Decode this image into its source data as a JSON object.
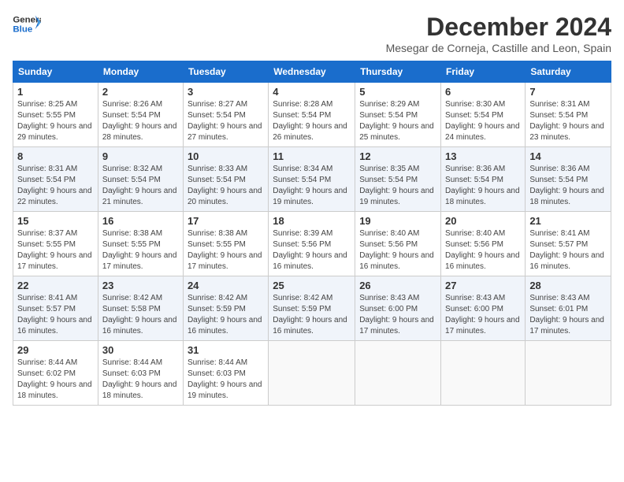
{
  "header": {
    "logo_line1": "General",
    "logo_line2": "Blue",
    "month": "December 2024",
    "location": "Mesegar de Corneja, Castille and Leon, Spain"
  },
  "weekdays": [
    "Sunday",
    "Monday",
    "Tuesday",
    "Wednesday",
    "Thursday",
    "Friday",
    "Saturday"
  ],
  "weeks": [
    [
      {
        "day": "1",
        "sunrise": "Sunrise: 8:25 AM",
        "sunset": "Sunset: 5:55 PM",
        "daylight": "Daylight: 9 hours and 29 minutes."
      },
      {
        "day": "2",
        "sunrise": "Sunrise: 8:26 AM",
        "sunset": "Sunset: 5:54 PM",
        "daylight": "Daylight: 9 hours and 28 minutes."
      },
      {
        "day": "3",
        "sunrise": "Sunrise: 8:27 AM",
        "sunset": "Sunset: 5:54 PM",
        "daylight": "Daylight: 9 hours and 27 minutes."
      },
      {
        "day": "4",
        "sunrise": "Sunrise: 8:28 AM",
        "sunset": "Sunset: 5:54 PM",
        "daylight": "Daylight: 9 hours and 26 minutes."
      },
      {
        "day": "5",
        "sunrise": "Sunrise: 8:29 AM",
        "sunset": "Sunset: 5:54 PM",
        "daylight": "Daylight: 9 hours and 25 minutes."
      },
      {
        "day": "6",
        "sunrise": "Sunrise: 8:30 AM",
        "sunset": "Sunset: 5:54 PM",
        "daylight": "Daylight: 9 hours and 24 minutes."
      },
      {
        "day": "7",
        "sunrise": "Sunrise: 8:31 AM",
        "sunset": "Sunset: 5:54 PM",
        "daylight": "Daylight: 9 hours and 23 minutes."
      }
    ],
    [
      {
        "day": "8",
        "sunrise": "Sunrise: 8:31 AM",
        "sunset": "Sunset: 5:54 PM",
        "daylight": "Daylight: 9 hours and 22 minutes."
      },
      {
        "day": "9",
        "sunrise": "Sunrise: 8:32 AM",
        "sunset": "Sunset: 5:54 PM",
        "daylight": "Daylight: 9 hours and 21 minutes."
      },
      {
        "day": "10",
        "sunrise": "Sunrise: 8:33 AM",
        "sunset": "Sunset: 5:54 PM",
        "daylight": "Daylight: 9 hours and 20 minutes."
      },
      {
        "day": "11",
        "sunrise": "Sunrise: 8:34 AM",
        "sunset": "Sunset: 5:54 PM",
        "daylight": "Daylight: 9 hours and 19 minutes."
      },
      {
        "day": "12",
        "sunrise": "Sunrise: 8:35 AM",
        "sunset": "Sunset: 5:54 PM",
        "daylight": "Daylight: 9 hours and 19 minutes."
      },
      {
        "day": "13",
        "sunrise": "Sunrise: 8:36 AM",
        "sunset": "Sunset: 5:54 PM",
        "daylight": "Daylight: 9 hours and 18 minutes."
      },
      {
        "day": "14",
        "sunrise": "Sunrise: 8:36 AM",
        "sunset": "Sunset: 5:54 PM",
        "daylight": "Daylight: 9 hours and 18 minutes."
      }
    ],
    [
      {
        "day": "15",
        "sunrise": "Sunrise: 8:37 AM",
        "sunset": "Sunset: 5:55 PM",
        "daylight": "Daylight: 9 hours and 17 minutes."
      },
      {
        "day": "16",
        "sunrise": "Sunrise: 8:38 AM",
        "sunset": "Sunset: 5:55 PM",
        "daylight": "Daylight: 9 hours and 17 minutes."
      },
      {
        "day": "17",
        "sunrise": "Sunrise: 8:38 AM",
        "sunset": "Sunset: 5:55 PM",
        "daylight": "Daylight: 9 hours and 17 minutes."
      },
      {
        "day": "18",
        "sunrise": "Sunrise: 8:39 AM",
        "sunset": "Sunset: 5:56 PM",
        "daylight": "Daylight: 9 hours and 16 minutes."
      },
      {
        "day": "19",
        "sunrise": "Sunrise: 8:40 AM",
        "sunset": "Sunset: 5:56 PM",
        "daylight": "Daylight: 9 hours and 16 minutes."
      },
      {
        "day": "20",
        "sunrise": "Sunrise: 8:40 AM",
        "sunset": "Sunset: 5:56 PM",
        "daylight": "Daylight: 9 hours and 16 minutes."
      },
      {
        "day": "21",
        "sunrise": "Sunrise: 8:41 AM",
        "sunset": "Sunset: 5:57 PM",
        "daylight": "Daylight: 9 hours and 16 minutes."
      }
    ],
    [
      {
        "day": "22",
        "sunrise": "Sunrise: 8:41 AM",
        "sunset": "Sunset: 5:57 PM",
        "daylight": "Daylight: 9 hours and 16 minutes."
      },
      {
        "day": "23",
        "sunrise": "Sunrise: 8:42 AM",
        "sunset": "Sunset: 5:58 PM",
        "daylight": "Daylight: 9 hours and 16 minutes."
      },
      {
        "day": "24",
        "sunrise": "Sunrise: 8:42 AM",
        "sunset": "Sunset: 5:59 PM",
        "daylight": "Daylight: 9 hours and 16 minutes."
      },
      {
        "day": "25",
        "sunrise": "Sunrise: 8:42 AM",
        "sunset": "Sunset: 5:59 PM",
        "daylight": "Daylight: 9 hours and 16 minutes."
      },
      {
        "day": "26",
        "sunrise": "Sunrise: 8:43 AM",
        "sunset": "Sunset: 6:00 PM",
        "daylight": "Daylight: 9 hours and 17 minutes."
      },
      {
        "day": "27",
        "sunrise": "Sunrise: 8:43 AM",
        "sunset": "Sunset: 6:00 PM",
        "daylight": "Daylight: 9 hours and 17 minutes."
      },
      {
        "day": "28",
        "sunrise": "Sunrise: 8:43 AM",
        "sunset": "Sunset: 6:01 PM",
        "daylight": "Daylight: 9 hours and 17 minutes."
      }
    ],
    [
      {
        "day": "29",
        "sunrise": "Sunrise: 8:44 AM",
        "sunset": "Sunset: 6:02 PM",
        "daylight": "Daylight: 9 hours and 18 minutes."
      },
      {
        "day": "30",
        "sunrise": "Sunrise: 8:44 AM",
        "sunset": "Sunset: 6:03 PM",
        "daylight": "Daylight: 9 hours and 18 minutes."
      },
      {
        "day": "31",
        "sunrise": "Sunrise: 8:44 AM",
        "sunset": "Sunset: 6:03 PM",
        "daylight": "Daylight: 9 hours and 19 minutes."
      },
      null,
      null,
      null,
      null
    ]
  ]
}
